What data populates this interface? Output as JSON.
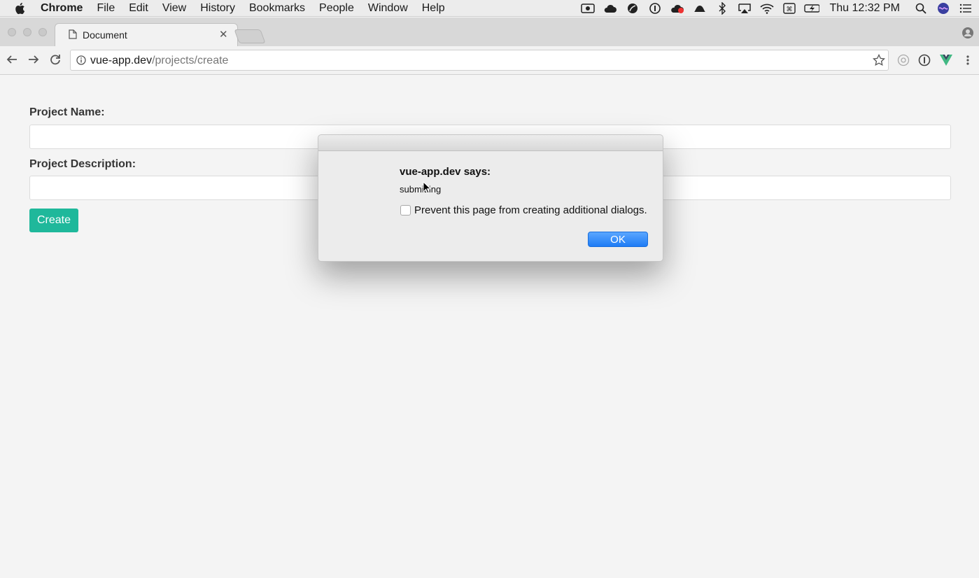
{
  "menubar": {
    "app": "Chrome",
    "items": [
      "File",
      "Edit",
      "View",
      "History",
      "Bookmarks",
      "People",
      "Window",
      "Help"
    ],
    "clock": "Thu 12:32 PM"
  },
  "tab": {
    "title": "Document"
  },
  "toolbar": {
    "url_host": "vue-app.dev",
    "url_path": "/projects/create"
  },
  "form": {
    "name_label": "Project Name:",
    "name_value": "",
    "description_label": "Project Description:",
    "description_value": "",
    "create_label": "Create"
  },
  "dialog": {
    "title": "vue-app.dev says:",
    "message": "submitting",
    "checkbox_label": "Prevent this page from creating additional dialogs.",
    "ok_label": "OK"
  },
  "colors": {
    "create_button": "#1fb89b",
    "ok_button": "#1e7cf5"
  }
}
